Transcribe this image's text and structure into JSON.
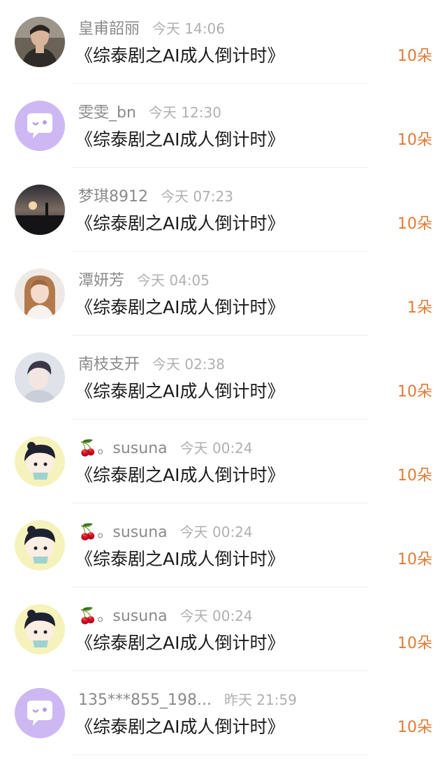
{
  "colors": {
    "name": "#8a8a8a",
    "time": "#b0b0b0",
    "title": "#1a1a1a",
    "gift": "#e07a35",
    "divider": "#eeeeee",
    "default_avatar_bg": "#cdb8f3"
  },
  "rows": [
    {
      "name": "皇甫韶丽",
      "time": "今天 14:06",
      "title": "《综泰剧之AI成人倒计时》",
      "gift": "10朵",
      "avatar": "photo-man-icon"
    },
    {
      "name": "雯雯_bn",
      "time": "今天 12:30",
      "title": "《综泰剧之AI成人倒计时》",
      "gift": "10朵",
      "avatar": "default-chat-bubble-icon"
    },
    {
      "name": "梦琪8912",
      "time": "今天 07:23",
      "title": "《综泰剧之AI成人倒计时》",
      "gift": "10朵",
      "avatar": "photo-sunset-icon"
    },
    {
      "name": "潭妍芳",
      "time": "今天 04:05",
      "title": "《综泰剧之AI成人倒计时》",
      "gift": "1朵",
      "avatar": "photo-girl-icon"
    },
    {
      "name": "南枝支开",
      "time": "今天 02:38",
      "title": "《综泰剧之AI成人倒计时》",
      "gift": "10朵",
      "avatar": "photo-anime-boy-icon"
    },
    {
      "name": "🍒。susuna",
      "time": "今天 00:24",
      "title": "《综泰剧之AI成人倒计时》",
      "gift": "10朵",
      "avatar": "cartoon-boy-icon"
    },
    {
      "name": "🍒。susuna",
      "time": "今天 00:24",
      "title": "《综泰剧之AI成人倒计时》",
      "gift": "10朵",
      "avatar": "cartoon-boy-icon"
    },
    {
      "name": "🍒。susuna",
      "time": "今天 00:24",
      "title": "《综泰剧之AI成人倒计时》",
      "gift": "10朵",
      "avatar": "cartoon-boy-icon"
    },
    {
      "name": "135***855_198...",
      "time": "昨天 21:59",
      "title": "《综泰剧之AI成人倒计时》",
      "gift": "10朵",
      "avatar": "default-chat-bubble-icon"
    }
  ]
}
